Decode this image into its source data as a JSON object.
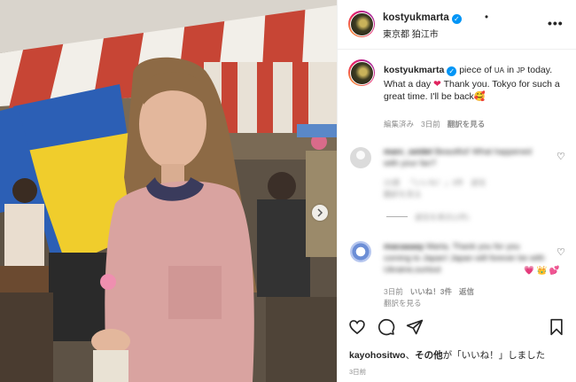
{
  "post": {
    "username": "kostyukmarta",
    "location": "東京都 狛江市",
    "more_label": "•••",
    "separator": "•"
  },
  "caption": {
    "username": "kostyukmarta",
    "text_before_heart": "piece of ",
    "text_flag1": "UA",
    "text_in": " in ",
    "text_flag2": "JP",
    "text_line": " today. What a day",
    "text_after_heart": "Thank you. Tokyo for such a great time. I'll be back",
    "meta_edited": "編集済み",
    "meta_time": "3日前",
    "meta_translate": "翻訳を見る"
  },
  "comments": [
    {
      "username": "marc_seidel",
      "text": "Beautiful! What happened with your fan?",
      "meta_time": "22週",
      "meta_likes": "「いいね！」3件",
      "meta_reply": "返信",
      "meta_translate": "翻訳を見る",
      "replies_label": "返信を表示(1件)"
    },
    {
      "username": "macaaaay",
      "text": "Marta, Thank you for you coming to Japan! Japan will forever be with Ukraine,surtout",
      "emoji": "💗 👑 💕",
      "meta_time": "3日前",
      "meta_likes": "いいね！3件",
      "meta_reply": "返信",
      "meta_translate": "翻訳を見る"
    }
  ],
  "footer": {
    "liked_by_user": "kayohositwo",
    "liked_by_rest": "、その他が「いいね！」しました",
    "liked_by_bold": "その他",
    "time": "3日前"
  },
  "colors": {
    "verified": "#0095f6",
    "heart": "#e0245e",
    "flag_blue": "#2c5fb5",
    "flag_yellow": "#f0cd2c"
  },
  "icons": [
    "verified-icon",
    "more-icon",
    "heart-icon",
    "comment-icon",
    "share-icon",
    "bookmark-icon",
    "next-arrow-icon"
  ]
}
